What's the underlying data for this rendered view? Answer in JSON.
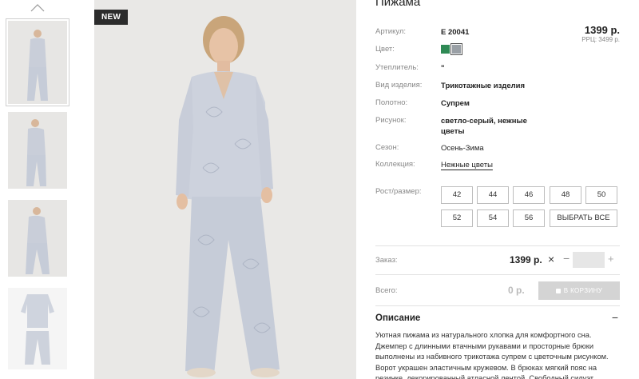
{
  "product": {
    "title": "Пижама",
    "badge": "NEW",
    "price": "1399 р.",
    "rrp": "РРЦ: 3499 р."
  },
  "attributes": [
    {
      "key": "Артикул:",
      "value": "E 20041"
    },
    {
      "key": "Цвет:",
      "value": ""
    },
    {
      "key": "Утеплитель:",
      "value": "\""
    },
    {
      "key": "Вид изделия:",
      "value": "Трикотажные изделия"
    },
    {
      "key": "Полотно:",
      "value": "Супрем"
    },
    {
      "key": "Рисунок:",
      "value": "светло-серый, нежные цветы"
    },
    {
      "key": "Сезон:",
      "value": "Осень-Зима"
    },
    {
      "key": "Коллекция:",
      "value": "Нежные цветы"
    }
  ],
  "colors": [
    "#2f8a55",
    "#9aa0a6"
  ],
  "sizes": {
    "label": "Рост/размер:",
    "items": [
      "42",
      "44",
      "46",
      "48",
      "50",
      "52",
      "54",
      "56"
    ],
    "select_all": "ВЫБРАТЬ ВСЕ"
  },
  "order": {
    "label": "Заказ:",
    "price": "1399 р.",
    "remove": "×",
    "minus": "−",
    "plus": "+",
    "qty": ""
  },
  "total": {
    "label": "Всего:",
    "value": "0 р.",
    "cart_button": "В КОРЗИНУ"
  },
  "description": {
    "heading": "Описание",
    "toggle": "−",
    "text": "Уютная пижама из натурального хлопка для комфортного сна. Джемпер с длинными втачными рукавами и просторные брюки выполнены из набивного трикотажа супрем с цветочным рисунком. Ворот украшен эластичным кружевом. В брюках мягкий пояс на резинке, декорированный атласной лентой. Свободный силуэт."
  },
  "icons": {
    "thumb_up": "chevron-up-icon",
    "cart": "cart-icon"
  }
}
